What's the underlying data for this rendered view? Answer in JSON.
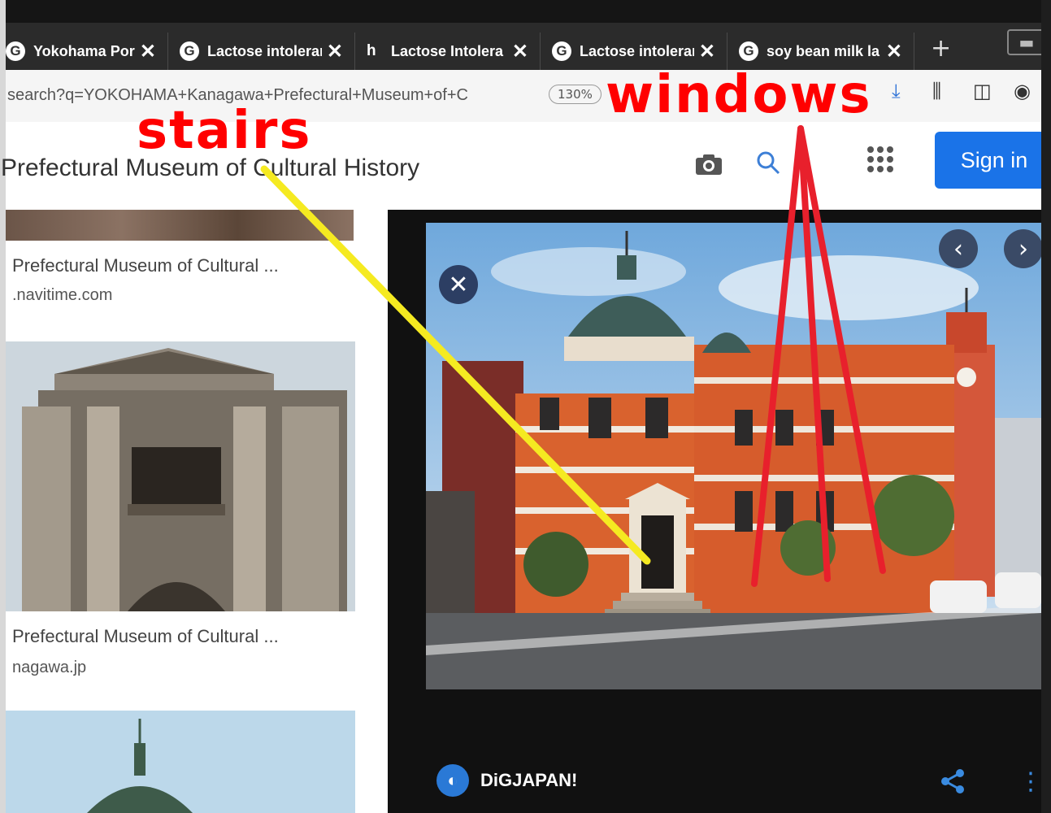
{
  "browser": {
    "tabs": [
      {
        "title": "Yokohama Port",
        "icon": "g-icon"
      },
      {
        "title": "Lactose intolerar",
        "icon": "google-icon"
      },
      {
        "title": "Lactose Intolera",
        "icon": "h-icon"
      },
      {
        "title": "Lactose intolerar",
        "icon": "google-icon"
      },
      {
        "title": "soy bean milk la",
        "icon": "google-icon"
      }
    ],
    "tab_close": "✕",
    "new_tab": "+",
    "url": "search?q=YOKOHAMA+Kanagawa+Prefectural+Museum+of+C",
    "zoom": "130%"
  },
  "search": {
    "query": "Prefectural Museum of Cultural History",
    "sign_in": "Sign in"
  },
  "results": [
    {
      "title": "Prefectural Museum of Cultural ...",
      "domain": ".navitime.com"
    },
    {
      "title": "Prefectural Museum of Cultural ...",
      "domain": "nagawa.jp"
    }
  ],
  "viewer": {
    "source": "DiGJAPAN!"
  },
  "annotations": {
    "stairs": "stairs",
    "windows": "windows",
    "stairs_color": "#ffff00",
    "windows_color": "#ff0000"
  }
}
